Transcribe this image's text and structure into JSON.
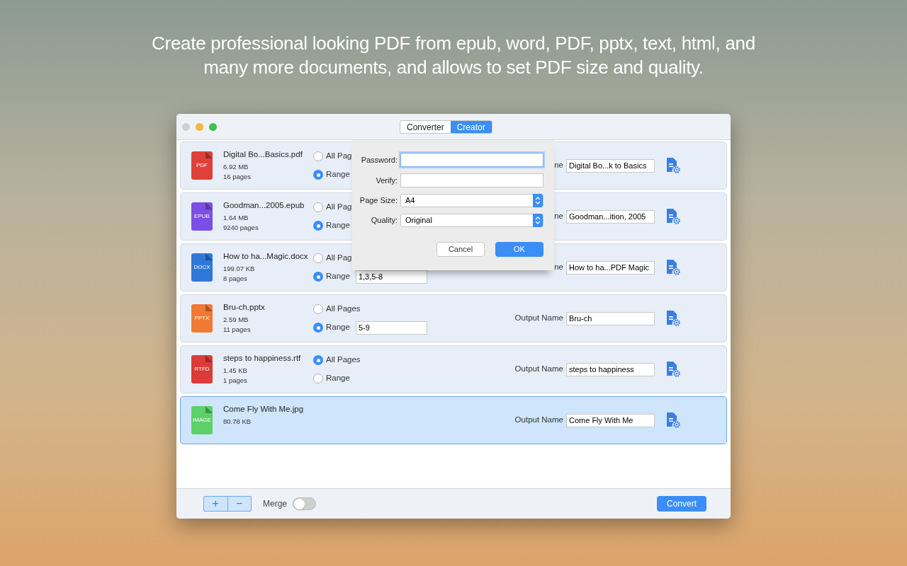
{
  "headline": "Create professional looking PDF from epub, word, PDF, pptx, text, html, and many more documents, and allows to set PDF size and quality.",
  "tabs": [
    {
      "label": "Converter",
      "selected": false
    },
    {
      "label": "Creator",
      "selected": true
    }
  ],
  "files": [
    {
      "badge": "PDF",
      "color": "#e0403a",
      "name": "Digital Bo...Basics.pdf",
      "size": "6.92 MB",
      "pages": "16 pages",
      "selected": false,
      "page_options": [
        {
          "label": "All Pag",
          "selected": false
        },
        {
          "label": "Range",
          "selected": true
        }
      ],
      "output_label": "ne",
      "output_name": "Digital Bo...k to Basics"
    },
    {
      "badge": "EPUB",
      "color": "#7b4fe6",
      "name": "Goodman...2005.epub",
      "size": "1.64 MB",
      "pages": "9240 pages",
      "selected": false,
      "page_options": [
        {
          "label": "All Pag",
          "selected": false
        },
        {
          "label": "Range",
          "selected": true
        }
      ],
      "output_label": "ne",
      "output_name": "Goodman...ition, 2005"
    },
    {
      "badge": "DOCX",
      "color": "#2f78d8",
      "name": "How to ha...Magic.docx",
      "size": "199.07 KB",
      "pages": "8 pages",
      "selected": false,
      "page_options": [
        {
          "label": "All Pag",
          "selected": false
        },
        {
          "label": "Range",
          "selected": true
        }
      ],
      "range": "1,3,5-8",
      "output_label": "ne",
      "output_name": "How to ha...PDF Magic"
    },
    {
      "badge": "PPTX",
      "color": "#f07a34",
      "name": "Bru-ch.pptx",
      "size": "2.59 MB",
      "pages": "11 pages",
      "selected": false,
      "page_options": [
        {
          "label": "All Pages",
          "selected": false
        },
        {
          "label": "Range",
          "selected": true
        }
      ],
      "range": "5-9",
      "output_label": "Output Name",
      "output_name": "Bru-ch"
    },
    {
      "badge": "RTFD",
      "color": "#dd3a3a",
      "name": "steps to happiness.rtf",
      "size": "1.45 KB",
      "pages": "1 pages",
      "selected": false,
      "page_options": [
        {
          "label": "All Pages",
          "selected": true
        },
        {
          "label": "Range",
          "selected": false
        }
      ],
      "output_label": "Output Name",
      "output_name": "steps to happiness"
    },
    {
      "badge": "IMAGE",
      "color": "#5cd16a",
      "name": "Come Fly With Me.jpg",
      "size": "80.78 KB",
      "selected": true,
      "output_label": "Output Name",
      "output_name": "Come Fly With Me"
    }
  ],
  "footer": {
    "add": "+",
    "remove": "−",
    "merge_label": "Merge",
    "merge_on": false,
    "convert": "Convert"
  },
  "dialog": {
    "fields": [
      {
        "kind": "text",
        "label": "Password:",
        "focused": true
      },
      {
        "kind": "text",
        "label": "Verify:",
        "focused": false
      },
      {
        "kind": "select",
        "label": "Page Size:",
        "value": "A4"
      },
      {
        "kind": "select",
        "label": "Quality:",
        "value": "Original"
      }
    ],
    "cancel": "Cancel",
    "ok": "OK"
  }
}
